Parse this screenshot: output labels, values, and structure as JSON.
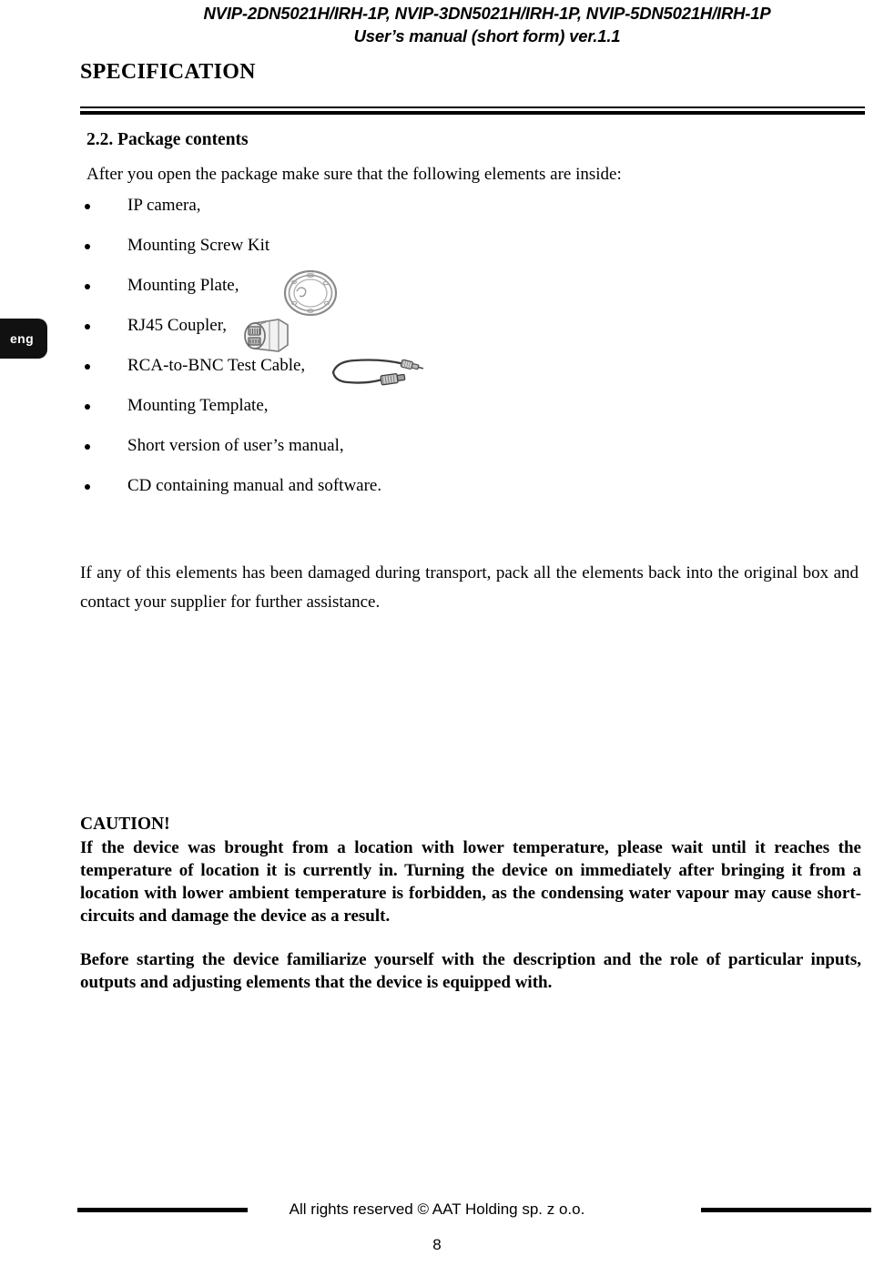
{
  "header": {
    "models_line": "NVIP-2DN5021H/IRH-1P, NVIP-3DN5021H/IRH-1P, NVIP-5DN5021H/IRH-1P",
    "manual_line": "User’s manual (short form) ver.1.1"
  },
  "section": {
    "title": "SPECIFICATION"
  },
  "subsection": {
    "heading": "2.2. Package contents",
    "intro": "After you open the package make sure that the following elements are inside:"
  },
  "package_items": [
    {
      "label": "IP camera,"
    },
    {
      "label": "Mounting Screw Kit"
    },
    {
      "label": "Mounting Plate,"
    },
    {
      "label": "RJ45 Coupler,"
    },
    {
      "label": "RCA-to-BNC Test Cable,"
    },
    {
      "label": "Mounting Template,"
    },
    {
      "label": "Short version of user’s manual,"
    },
    {
      "label": "CD containing manual and software."
    }
  ],
  "artwork": [
    {
      "name": "mounting-plate-illustration"
    },
    {
      "name": "rj45-coupler-illustration"
    },
    {
      "name": "rca-to-bnc-cable-illustration"
    }
  ],
  "language_tab": {
    "label": "eng"
  },
  "body": {
    "damaged_paragraph": "If any of this elements has been damaged during transport, pack all the elements back into the original box and contact your supplier for further assistance.",
    "caution_title": "CAUTION!",
    "caution_paragraph": "If the device was brought from a location with lower temperature, please wait until it reaches the temperature of location it is currently in. Turning the device on immediately after bringing it from a location with lower ambient temperature is forbidden, as the condensing water vapour may cause short-circuits and damage the device as a result.",
    "before_paragraph": "Before starting the device familiarize yourself with the description and the role of particular inputs, outputs and adjusting elements that the device is equipped with."
  },
  "footer": {
    "copyright": "All rights reserved © AAT Holding sp. z o.o.",
    "page_number": "8"
  },
  "colors": {
    "text": "#000000",
    "background": "#ffffff",
    "tab_background": "#111111",
    "tab_text": "#ffffff",
    "artwork_stroke": "#6e6e6e"
  }
}
